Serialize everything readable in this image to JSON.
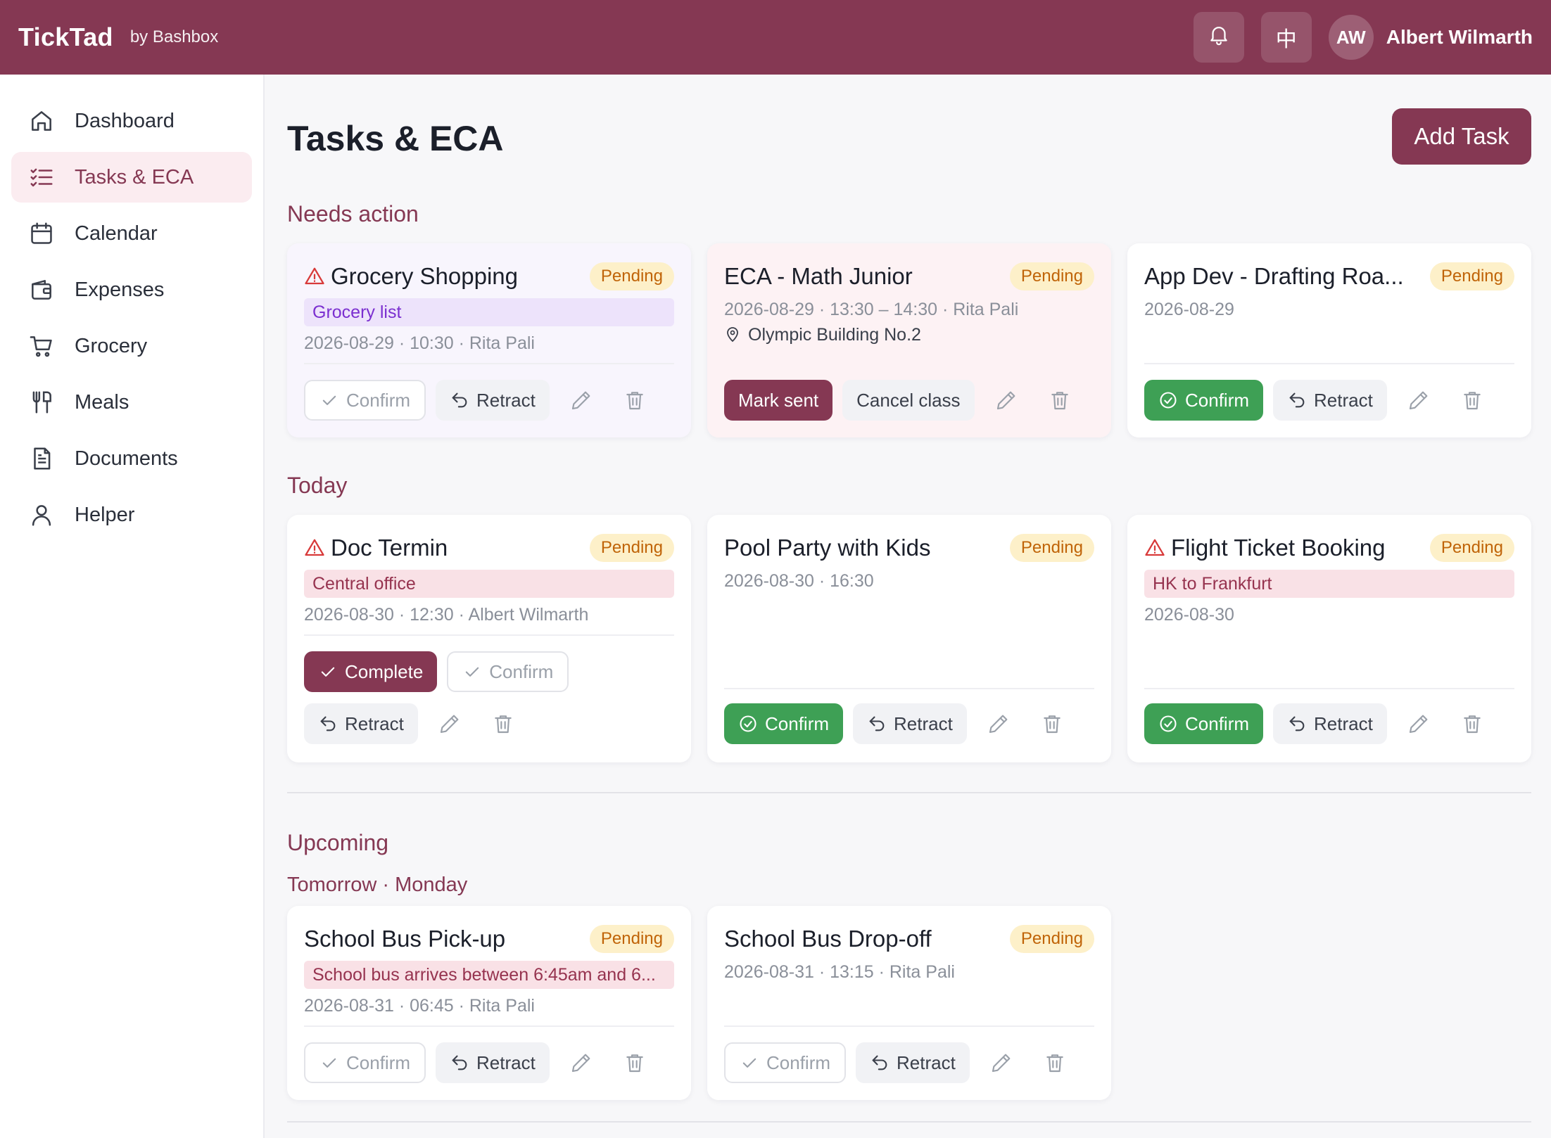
{
  "app": {
    "brand": "TickTad",
    "brand_sub": "by Bashbox",
    "lang_label": "中",
    "user_initials": "AW",
    "user_name": "Albert Wilmarth",
    "bell_icon": "bell-icon",
    "accent_color": "#853853"
  },
  "sidebar": {
    "items": [
      {
        "label": "Dashboard",
        "icon": "home-icon"
      },
      {
        "label": "Tasks & ECA",
        "icon": "checklist-icon",
        "active": true
      },
      {
        "label": "Calendar",
        "icon": "calendar-icon"
      },
      {
        "label": "Expenses",
        "icon": "wallet-icon"
      },
      {
        "label": "Grocery",
        "icon": "cart-icon"
      },
      {
        "label": "Meals",
        "icon": "utensils-icon"
      },
      {
        "label": "Documents",
        "icon": "document-icon"
      },
      {
        "label": "Helper",
        "icon": "user-icon"
      }
    ]
  },
  "page": {
    "title": "Tasks & ECA",
    "add_task": "Add Task"
  },
  "sections": {
    "needs_action": "Needs action",
    "today": "Today",
    "upcoming": "Upcoming",
    "tomorrow": "Tomorrow · Monday"
  },
  "labels": {
    "pending": "Pending",
    "confirm": "Confirm",
    "retract": "Retract",
    "complete": "Complete",
    "mark_sent": "Mark sent",
    "cancel_class": "Cancel class"
  },
  "cards": {
    "grocery": {
      "title": "Grocery Shopping",
      "tag": "Grocery list",
      "meta": "2026-08-29 · 10:30 · Rita Pali"
    },
    "eca": {
      "title": "ECA - Math Junior",
      "meta": "2026-08-29 · 13:30 – 14:30 · Rita Pali",
      "location": "Olympic Building No.2"
    },
    "appdev": {
      "title": "App Dev - Drafting Roa...",
      "meta": "2026-08-29"
    },
    "doc": {
      "title": "Doc Termin",
      "tag": "Central office",
      "meta": "2026-08-30 · 12:30 · Albert Wilmarth"
    },
    "pool": {
      "title": "Pool Party with Kids",
      "meta": "2026-08-30 · 16:30"
    },
    "flight": {
      "title": "Flight Ticket Booking",
      "tag": "HK to Frankfurt",
      "meta": "2026-08-30"
    },
    "pickup": {
      "title": "School Bus Pick-up",
      "tag": "School bus arrives between 6:45am and 6...",
      "meta": "2026-08-31 · 06:45 · Rita Pali"
    },
    "dropoff": {
      "title": "School Bus Drop-off",
      "meta": "2026-08-31 · 13:15 · Rita Pali"
    }
  }
}
